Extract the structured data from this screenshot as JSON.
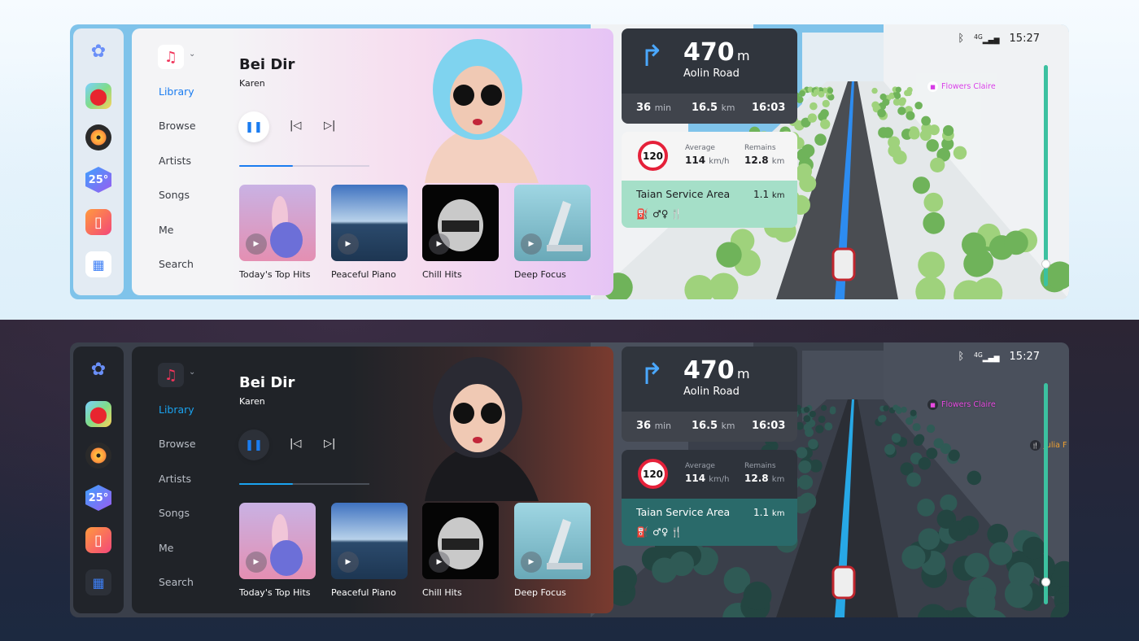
{
  "screens": [
    {
      "theme": "light",
      "colors": {
        "accent": "#1a7cf0",
        "card_bg": "#f2f2f4",
        "text": "#1c1c20",
        "subtext": "#666a73",
        "map_ground": "#e4e8ea",
        "tree": "#9fd27c",
        "tree_dark": "#6fb35a",
        "road": "#4a4d52",
        "route": "#2d8cf0",
        "building": "#f0f2f4",
        "sky": "#7fc3ea",
        "poi": "#d63ce6",
        "service_bg": "#a5dfc8",
        "limit_bg": "#f5f5f5"
      },
      "music": {
        "app_icon": "music-note-icon",
        "title": "Bei Dir",
        "artist": "Karen",
        "progress": 0.41,
        "nav": [
          {
            "label": "Library",
            "active": true
          },
          {
            "label": "Browse"
          },
          {
            "label": "Artists"
          },
          {
            "label": "Songs"
          },
          {
            "label": "Me"
          },
          {
            "label": "Search"
          }
        ],
        "albums": [
          {
            "label": "Today's Top Hits"
          },
          {
            "label": "Peaceful Piano"
          },
          {
            "label": "Chill Hits"
          },
          {
            "label": "Deep Focus"
          }
        ]
      },
      "navigation": {
        "distance": "470",
        "distance_unit": "m",
        "street": "Aolin Road",
        "eta_time": "36",
        "eta_time_unit": "min",
        "remaining_distance": "16.5",
        "remaining_distance_unit": "km",
        "arrival": "16:03",
        "speed_limit": "120",
        "average_label": "Average",
        "average_value": "114",
        "average_unit": "km/h",
        "remains_label": "Remains",
        "remains_value": "12.8",
        "remains_unit": "km",
        "service_area": "Taian Service Area",
        "service_distance": "1.1",
        "service_distance_unit": "km",
        "amenities": [
          "fuel-icon",
          "restroom-icon",
          "restaurant-icon"
        ]
      },
      "status": {
        "time": "15:27",
        "network": "4G"
      },
      "map": {
        "pois": [
          {
            "label": "Flowers Claire",
            "icon": "shopping-bag-icon"
          }
        ],
        "zoom_level": 0.1
      }
    },
    {
      "theme": "dark",
      "colors": {
        "accent": "#1aa3f0",
        "card_bg": "#202328",
        "text": "#ffffff",
        "subtext": "#9aa0aa",
        "map_ground": "#3a3f4a",
        "tree": "#2f5a55",
        "tree_dark": "#234541",
        "road": "#2b2e35",
        "route": "#27a8e6",
        "building": "#4a505c",
        "sky": "#3a3f4a",
        "poi": "#e84ae0",
        "service_bg": "#2a6a6a",
        "limit_bg": "#2e333b"
      },
      "music": {
        "app_icon": "music-note-icon",
        "title": "Bei Dir",
        "artist": "Karen",
        "progress": 0.41,
        "nav": [
          {
            "label": "Library",
            "active": true
          },
          {
            "label": "Browse"
          },
          {
            "label": "Artists"
          },
          {
            "label": "Songs"
          },
          {
            "label": "Me"
          },
          {
            "label": "Search"
          }
        ],
        "albums": [
          {
            "label": "Today's Top Hits"
          },
          {
            "label": "Peaceful Piano"
          },
          {
            "label": "Chill Hits"
          },
          {
            "label": "Deep Focus"
          }
        ]
      },
      "navigation": {
        "distance": "470",
        "distance_unit": "m",
        "street": "Aolin Road",
        "eta_time": "36",
        "eta_time_unit": "min",
        "remaining_distance": "16.5",
        "remaining_distance_unit": "km",
        "arrival": "16:03",
        "speed_limit": "120",
        "average_label": "Average",
        "average_value": "114",
        "average_unit": "km/h",
        "remains_label": "Remains",
        "remains_value": "12.8",
        "remains_unit": "km",
        "service_area": "Taian Service Area",
        "service_distance": "1.1",
        "service_distance_unit": "km",
        "amenities": [
          "fuel-icon",
          "restroom-icon",
          "restaurant-icon"
        ]
      },
      "status": {
        "time": "15:27",
        "network": "4G"
      },
      "map": {
        "pois": [
          {
            "label": "Flowers Claire",
            "icon": "shopping-bag-icon"
          },
          {
            "label": "Julia F",
            "icon": "restaurant-icon"
          }
        ],
        "zoom_level": 0.1
      }
    }
  ],
  "dock": {
    "apps": [
      {
        "name": "home-logo-icon"
      },
      {
        "name": "maps-app-icon"
      },
      {
        "name": "music-app-icon"
      },
      {
        "name": "weather-app-icon",
        "label": "25°"
      },
      {
        "name": "car-app-icon"
      },
      {
        "name": "all-apps-icon"
      }
    ]
  }
}
